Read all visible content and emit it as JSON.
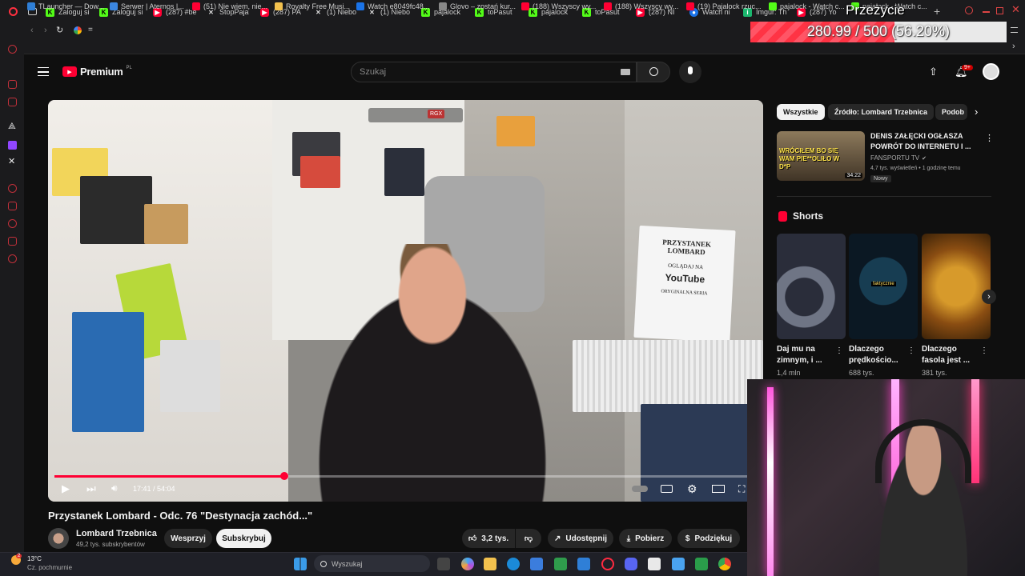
{
  "browser": {
    "tabs": [
      {
        "label": "Zaloguj si",
        "icon": "kick-icon"
      },
      {
        "label": "Zaloguj si",
        "icon": "kick-icon"
      },
      {
        "label": "(287) #be",
        "icon": "youtube-icon"
      },
      {
        "label": "StopPaja",
        "icon": "x-icon"
      },
      {
        "label": "(287) PA",
        "icon": "youtube-icon"
      },
      {
        "label": "(1) Niebo",
        "icon": "x-icon"
      },
      {
        "label": "(1) Niebo",
        "icon": "x-icon"
      },
      {
        "label": "pajalock",
        "icon": "kick-icon"
      },
      {
        "label": "toPasut",
        "icon": "kick-icon"
      },
      {
        "label": "pajalock",
        "icon": "kick-icon"
      },
      {
        "label": "toPasut",
        "icon": "kick-icon"
      },
      {
        "label": "(287) NI",
        "icon": "youtube-icon"
      },
      {
        "label": "Watch ni",
        "icon": "globe-icon"
      },
      {
        "label": "Imgur: Th",
        "icon": "imgur-icon"
      },
      {
        "label": "(287) Yo",
        "icon": "youtube-icon"
      }
    ],
    "url": "=",
    "bookmarks": [
      {
        "label": "TLauncher — Dow..."
      },
      {
        "label": "Serwer | Aternos |..."
      },
      {
        "label": "(51) Nie wiem, nie..."
      },
      {
        "label": "Royalty Free Musi..."
      },
      {
        "label": "Watch e8049fc48..."
      },
      {
        "label": "Glovo – zostań kur..."
      },
      {
        "label": "(188) Wszyscy wy..."
      },
      {
        "label": "(188) Wszyscy wy..."
      },
      {
        "label": "(19) Pajalock rzuc..."
      },
      {
        "label": "pajalock - Watch c..."
      },
      {
        "label": "pajalock - Watch c..."
      }
    ]
  },
  "overlay": {
    "title": "Przeżycie",
    "progress_text": "280.99 / 500 (56.20%)",
    "progress_fraction": 0.562
  },
  "youtube": {
    "logo": "Premium",
    "logo_region": "PL",
    "search_placeholder": "Szukaj",
    "notifications_badge": "9+"
  },
  "video": {
    "title": "Przystanek Lombard - Odc. 76 \"Destynacja zachód...\"",
    "time": "17:41 / 54:04",
    "progress_fraction": 0.327,
    "sign_text": [
      "PRZYSTANEK",
      "LOMBARD",
      "OGLĄDAJ NA",
      "YouTube",
      "ORYGINALNA SERIA"
    ],
    "overlay_badge": "RGX",
    "channel": "Lombard Trzebnica",
    "subscribers": "49,2 tys. subskrybentów",
    "buttons": {
      "support": "Wesprzyj",
      "subscribe": "Subskrybuj",
      "likes": "3,2 tys.",
      "share": "Udostępnij",
      "download": "Pobierz",
      "thanks": "Podziękuj"
    }
  },
  "sidebar": {
    "chips": [
      "Wszystkie",
      "Źródło: Lombard Trzebnica",
      "Podob"
    ],
    "recommended": {
      "title": "DENIS ZAŁĘCKI OGŁASZA POWRÓT DO INTERNETU I ...",
      "channel": "FANSPORTU TV",
      "meta": "4,7 tys. wyświetleń • 1 godzinę temu",
      "badge": "Nowy",
      "duration": "34:22",
      "thumb_text": "WRÓCIŁEM BO SIĘ WAM PIE**OLIŁO W D*P"
    },
    "shorts_heading": "Shorts",
    "shorts": [
      {
        "title": "Daj mu na zimnym, i ...",
        "views": "1,4 mln"
      },
      {
        "title": "Dlaczego prędkościo...",
        "views": "688 tys."
      },
      {
        "title": "Dlaczego fasola jest ...",
        "views": "381 tys."
      }
    ],
    "speedo_label": "faktycznie"
  },
  "taskbar": {
    "weather_temp": "13°C",
    "weather_desc": "Cz. pochmurnie",
    "weather_badge": "2",
    "search_placeholder": "Wyszukaj"
  }
}
